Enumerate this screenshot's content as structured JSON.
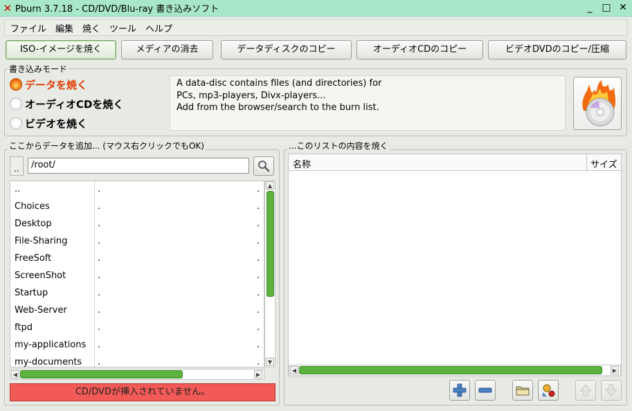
{
  "window": {
    "title": "Pburn 3.7.18 - CD/DVD/Blu-ray 書き込みソフト",
    "minimize": "_",
    "maximize": "□",
    "close": "✕"
  },
  "menu": [
    "ファイル",
    "編集",
    "焼く",
    "ツール",
    "ヘルプ"
  ],
  "toolbar": [
    "ISO-イメージを焼く",
    "メディアの消去",
    "データディスクのコピー",
    "オーディオCDのコピー",
    "ビデオDVDのコピー/圧縮"
  ],
  "burn_mode": {
    "label": "書き込みモード",
    "options": [
      "データを焼く",
      "オーディオCDを焼く",
      "ビデオを焼く"
    ],
    "selected": 0,
    "description": [
      "A data-disc contains files (and directories) for",
      "PCs, mp3-players, Divx-players...",
      "Add from the browser/search to the burn list."
    ]
  },
  "browser": {
    "label": "ここからデータを追加... (マウス右クリックでもOK)",
    "up_label": "..",
    "path": "/root/",
    "files": [
      {
        "name": "..",
        "c1": ".",
        "c2": "."
      },
      {
        "name": "Choices",
        "c1": ".",
        "c2": "."
      },
      {
        "name": "Desktop",
        "c1": ".",
        "c2": "."
      },
      {
        "name": "File-Sharing",
        "c1": ".",
        "c2": "."
      },
      {
        "name": "FreeSoft",
        "c1": ".",
        "c2": "."
      },
      {
        "name": "ScreenShot",
        "c1": ".",
        "c2": "."
      },
      {
        "name": "Startup",
        "c1": ".",
        "c2": "."
      },
      {
        "name": "Web-Server",
        "c1": ".",
        "c2": "."
      },
      {
        "name": "ftpd",
        "c1": ".",
        "c2": "."
      },
      {
        "name": "my-applications",
        "c1": ".",
        "c2": "."
      },
      {
        "name": "my-documents",
        "c1": ".",
        "c2": "."
      }
    ],
    "status": "CD/DVDが挿入されていません。"
  },
  "burnlist": {
    "label": "...このリストの内容を焼く",
    "columns": [
      "名称",
      "サイズ"
    ]
  },
  "colors": {
    "accent": "#5bb33e",
    "status_bg": "#f15a56",
    "title_bg": "#a8e8c8"
  }
}
